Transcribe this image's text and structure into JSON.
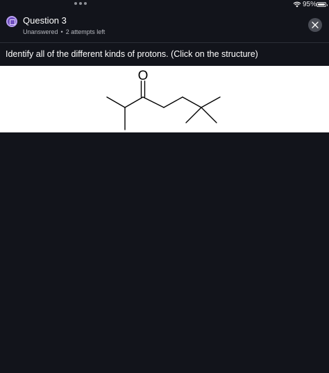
{
  "status_bar": {
    "battery_percent": "95%",
    "icons": [
      "multitask-dots-icon",
      "wifi-icon",
      "battery-icon"
    ]
  },
  "header": {
    "title": "Question 3",
    "status": "Unanswered",
    "separator": "•",
    "attempts": "2 attempts left",
    "icons": [
      "question-icon",
      "close-icon"
    ]
  },
  "prompt": {
    "text": "Identify all of the different kinds of protons. (Click on the structure)"
  },
  "structure": {
    "oxygen_label": "O"
  },
  "colors": {
    "background": "#12141b",
    "accent": "#6f4fbe",
    "panel": "#ffffff"
  }
}
